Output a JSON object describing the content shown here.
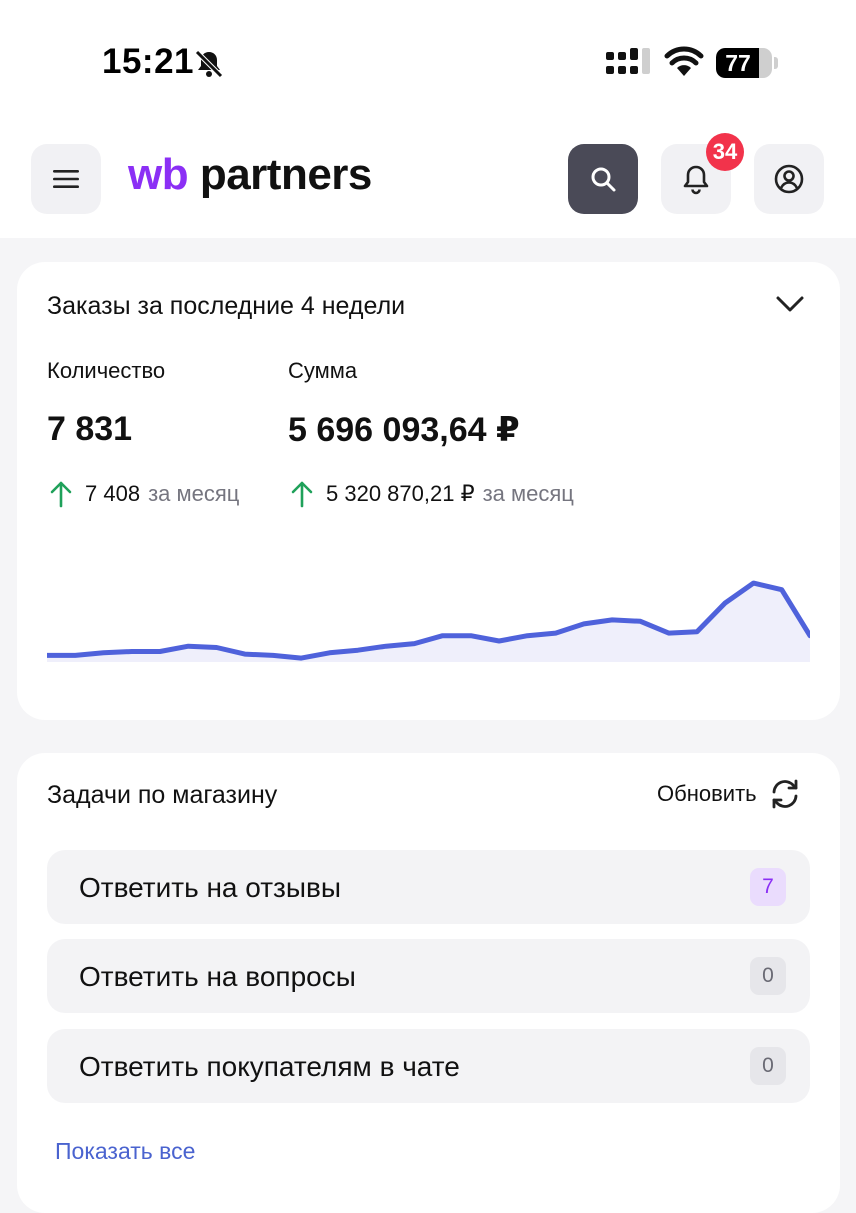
{
  "status_bar": {
    "time": "15:21",
    "battery": "77",
    "battery_level": 0.77,
    "icons": [
      "bell-slash-icon",
      "cellular-signal-icon",
      "wifi-icon",
      "battery-icon"
    ]
  },
  "header": {
    "logo_wb": "wb",
    "logo_partners": " partners",
    "notifications_count": "34",
    "icons": [
      "hamburger-menu-icon",
      "search-icon",
      "bell-icon",
      "user-icon"
    ],
    "colors": {
      "brand": "#8b2ff5",
      "badge": "#f2334b",
      "search_button": "#4a4a57"
    }
  },
  "orders": {
    "title": "Заказы за последние 4 недели",
    "quantity_label": "Количество",
    "quantity_value": "7 831",
    "quantity_prev": "7 408",
    "sum_label": "Сумма",
    "sum_value": "5 696 093,64 ₽",
    "sum_prev": "5 320 870,21 ₽",
    "period_text": "за месяц",
    "trend_color": "#1fa15a"
  },
  "chart_data": {
    "type": "area",
    "title": "",
    "xlabel": "",
    "ylabel": "",
    "values": [
      5,
      5,
      7,
      8,
      8,
      12,
      11,
      6,
      5,
      3,
      7,
      9,
      12,
      14,
      20,
      20,
      16,
      20,
      22,
      29,
      32,
      31,
      22,
      23,
      45,
      60,
      55,
      20
    ],
    "ylim": [
      0,
      70
    ],
    "grid": false,
    "legend": "none",
    "line_color": "#4f62db",
    "fill_color": "#efeffb"
  },
  "tasks": {
    "title": "Задачи по магазину",
    "refresh_label": "Обновить",
    "items": [
      {
        "label": "Ответить на отзывы",
        "count": "7",
        "active": true
      },
      {
        "label": "Ответить на вопросы",
        "count": "0",
        "active": false
      },
      {
        "label": "Ответить покупателям в чате",
        "count": "0",
        "active": false
      }
    ],
    "show_all": "Показать все"
  }
}
